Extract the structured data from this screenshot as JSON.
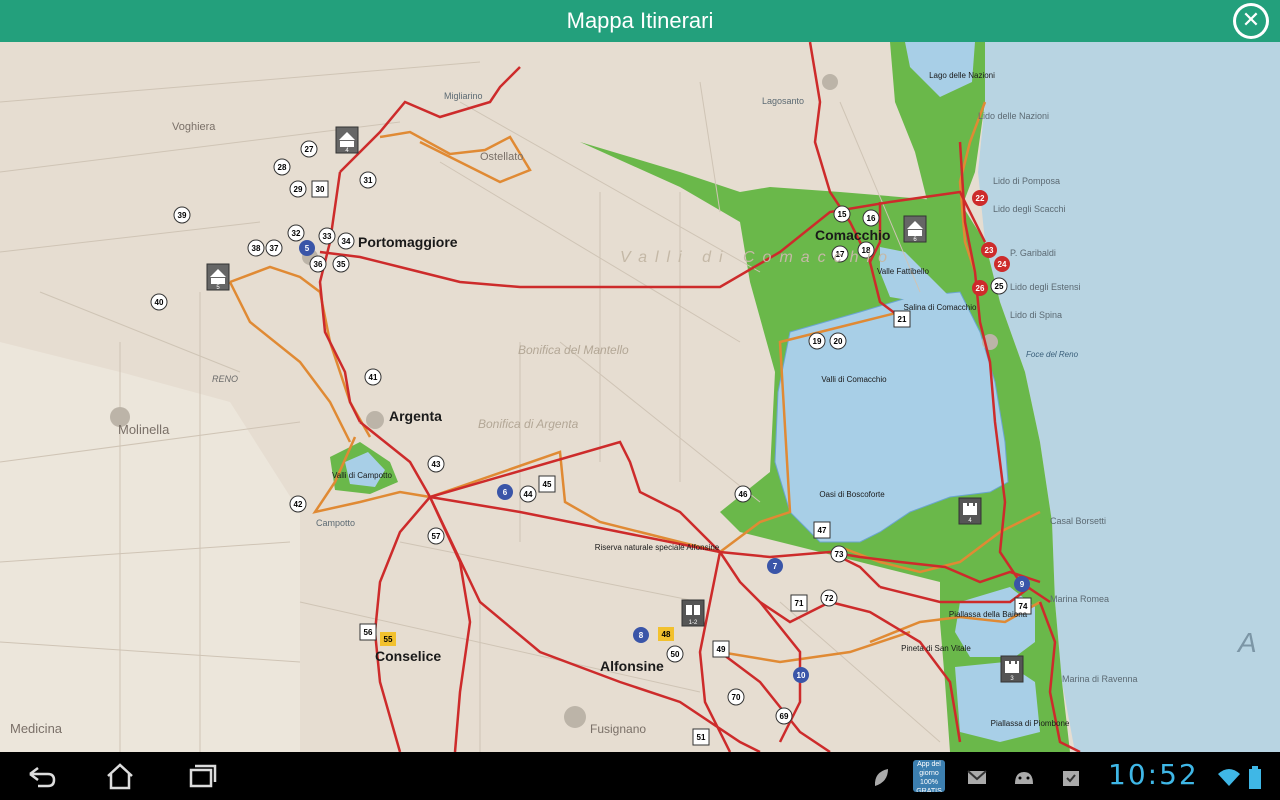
{
  "header": {
    "title": "Mappa Itinerari",
    "close_icon": "close-circle-icon"
  },
  "colors": {
    "header_bg": "#23a07c",
    "sea": "#b7d3e2",
    "lagoon": "#a8cfe7",
    "park": "#6ab84a",
    "land": "#e6ddd1",
    "road_red": "#cd2b2b",
    "route_orange": "#e08a34",
    "clock": "#3fb7e6"
  },
  "map": {
    "cities": {
      "portomaggiore": "Portomaggiore",
      "argenta": "Argenta",
      "comacchio": "Comacchio",
      "conselice": "Conselice",
      "alfonsine": "Alfonsine",
      "molinella": "Molinella",
      "medicina": "Medicina",
      "voghiera": "Voghiera",
      "ostellato": "Ostellato",
      "fusignano": "Fusignano"
    },
    "areas": {
      "valli_comacchio": "Valli di Comacchio",
      "oasi": "Oasi di Boscoforte",
      "salina": "Salina di Comacchio",
      "valle_fattibello": "Valle Fattibello",
      "valli_campotto": "Valli di Campotto",
      "riserva": "Riserva naturale speciale Alfonsine",
      "piallassa_baiona": "Piallassa della Baiona",
      "pineta": "Pineta di San Vitale",
      "piallassa_piombone": "Piallassa di Piombone",
      "lago_nazioni": "Lago delle Nazioni",
      "foce_reno": "Foce del Reno"
    },
    "places": {
      "lido_nazioni": "Lido delle Nazioni",
      "lido_pomposa": "Lido di Pomposa",
      "lido_scacchi": "Lido degli Scacchi",
      "garibaldi": "P. Garibaldi",
      "lido_estensi": "Lido degli Estensi",
      "lido_spina": "Lido di Spina",
      "casal_borsetti": "Casal Borsetti",
      "marina_romea": "Marina Romea",
      "marina_ravenna": "Marina di Ravenna",
      "reno": "RENO",
      "campotto": "Campotto",
      "migliarino": "Migliarino",
      "lagosanto": "Lagosanto",
      "bonifica_mantello": "Bonifica del Mantello",
      "bonifica_argenta": "Bonifica di Argenta",
      "valli_big": "Valli di Comacchio",
      "sea_letter": "A"
    },
    "markers_circle": [
      "27",
      "28",
      "29",
      "31",
      "32",
      "33",
      "34",
      "35",
      "36",
      "37",
      "38",
      "39",
      "40",
      "41",
      "42",
      "43",
      "44",
      "46",
      "50",
      "57",
      "69",
      "70",
      "72",
      "73",
      "15",
      "16",
      "17",
      "18",
      "19",
      "20",
      "25"
    ],
    "markers_square": [
      "30",
      "45",
      "47",
      "49",
      "51",
      "56",
      "71",
      "74",
      "21"
    ],
    "markers_blue": [
      "5",
      "6",
      "7",
      "8",
      "9",
      "10"
    ],
    "markers_red": [
      "22",
      "23",
      "24",
      "26"
    ],
    "markers_yellow": [
      "55",
      "48"
    ],
    "museum_badges": [
      "4",
      "5"
    ],
    "unesco_badges": [
      "6"
    ],
    "castle_badges": [
      "4",
      "3"
    ],
    "book_badge": "1-2"
  },
  "navbar": {
    "back_icon": "back-icon",
    "home_icon": "home-icon",
    "recent_icon": "recent-apps-icon",
    "clock": "10:52",
    "app_badge": {
      "line1": "App del",
      "line2": "giorno",
      "line3": "100% GRATIS"
    }
  }
}
